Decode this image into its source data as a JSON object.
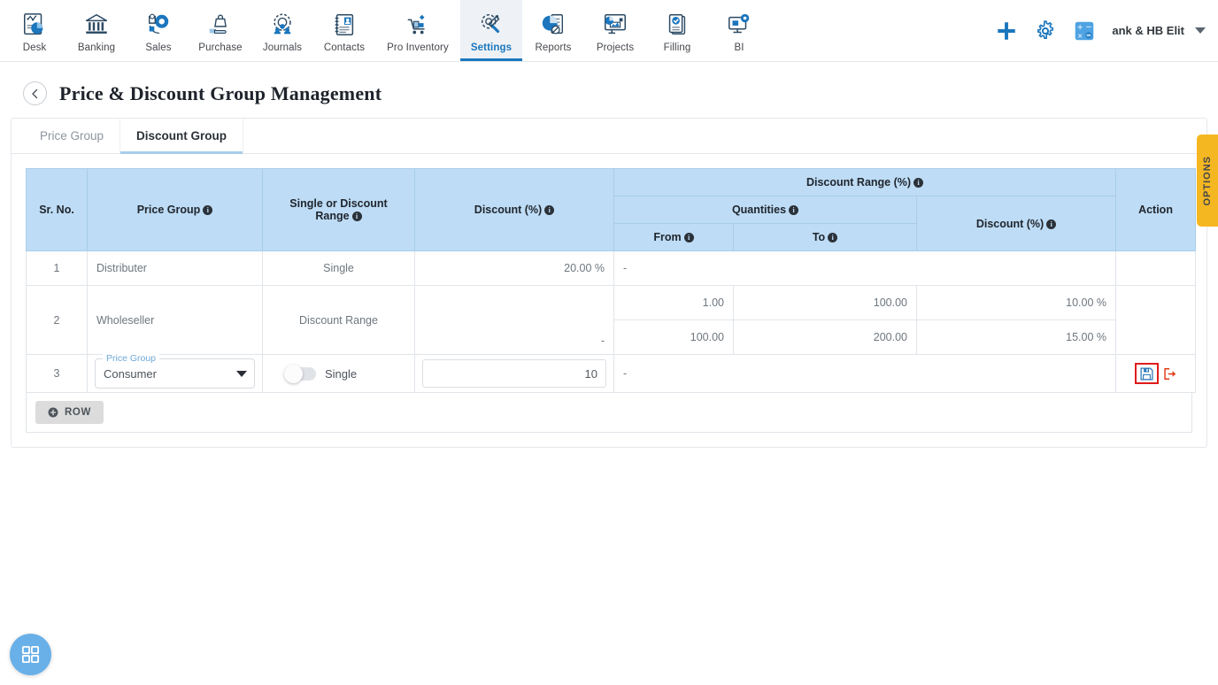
{
  "topnav": {
    "items": [
      {
        "label": "Desk",
        "icon": "desk-chart-icon",
        "active": false
      },
      {
        "label": "Banking",
        "icon": "bank-building-icon",
        "active": false
      },
      {
        "label": "Sales",
        "icon": "sales-gear-icon",
        "active": false
      },
      {
        "label": "Purchase",
        "icon": "purchase-hand-bag-icon",
        "active": false
      },
      {
        "label": "Journals",
        "icon": "journals-gear-people-icon",
        "active": false
      },
      {
        "label": "Contacts",
        "icon": "contacts-book-icon",
        "active": false
      },
      {
        "label": "Pro Inventory",
        "icon": "inventory-cart-icon",
        "active": false
      },
      {
        "label": "Settings",
        "icon": "settings-tools-icon",
        "active": true
      },
      {
        "label": "Reports",
        "icon": "reports-pie-icon",
        "active": false
      },
      {
        "label": "Projects",
        "icon": "projects-board-icon",
        "active": false
      },
      {
        "label": "Filling",
        "icon": "filling-check-docs-icon",
        "active": false
      },
      {
        "label": "BI",
        "icon": "bi-monitor-gear-icon",
        "active": false
      }
    ],
    "actions": {
      "add_label": "add-icon",
      "settings_label": "gear-icon",
      "calculator_label": "calculator-icon"
    },
    "company": "ank & HB Elit",
    "accent": "#1b76bd"
  },
  "page": {
    "title": "Price & Discount Group Management",
    "back_label": "back-icon",
    "options_tab": "OPTIONS"
  },
  "tabs": [
    {
      "label": "Price Group",
      "active": false
    },
    {
      "label": "Discount Group",
      "active": true
    }
  ],
  "table": {
    "headers": {
      "sr_no": "Sr. No.",
      "price_group": "Price Group",
      "single_or_range": "Single or Discount Range",
      "discount_pct": "Discount (%)",
      "discount_range_group": "Discount Range (%)",
      "quantities": "Quantities",
      "from": "From",
      "to": "To",
      "range_discount_pct": "Discount (%)",
      "action": "Action"
    },
    "rows": [
      {
        "sr_no": "1",
        "price_group": "Distributer",
        "mode": "Single",
        "discount": "20.00 %",
        "range_placeholder": "-",
        "ranges": []
      },
      {
        "sr_no": "2",
        "price_group": "Wholeseller",
        "mode": "Discount Range",
        "discount": "-",
        "ranges": [
          {
            "from": "1.00",
            "to": "100.00",
            "discount": "10.00 %"
          },
          {
            "from": "100.00",
            "to": "200.00",
            "discount": "15.00 %"
          }
        ]
      }
    ],
    "edit_row": {
      "sr_no": "3",
      "price_group_label": "Price Group",
      "price_group_value": "Consumer",
      "toggle_label": "Single",
      "toggle_on": false,
      "discount_value": "10",
      "discount_placeholder": "",
      "range_placeholder": "-",
      "save_label": "save-icon",
      "cancel_label": "exit-icon",
      "highlight_color": "#e01b1b"
    },
    "add_row_button": "ROW",
    "header_bg": "#bedcf5"
  },
  "fab": {
    "label": "apps-grid-icon",
    "color": "#69b0e8"
  }
}
